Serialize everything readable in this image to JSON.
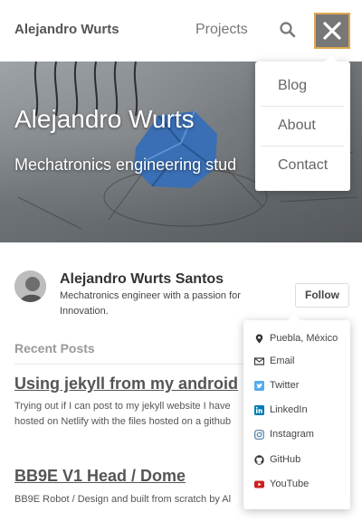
{
  "header": {
    "brand": "Alejandro Wurts",
    "nav_projects": "Projects"
  },
  "hero": {
    "title": "Alejandro Wurts",
    "subtitle": "Mechatronics engineering stud"
  },
  "menu": {
    "items": [
      {
        "label": "Blog"
      },
      {
        "label": "About"
      },
      {
        "label": "Contact"
      }
    ]
  },
  "author": {
    "name": "Alejandro Wurts Santos",
    "bio": "Mechatronics engineer with a passion for Innovation.",
    "follow_label": "Follow"
  },
  "follow_menu": {
    "items": [
      {
        "label": "Puebla, México",
        "icon": "map-marker-icon",
        "color": "#333333"
      },
      {
        "label": "Email",
        "icon": "envelope-icon",
        "color": "#333333"
      },
      {
        "label": "Twitter",
        "icon": "twitter-icon",
        "color": "#55acee"
      },
      {
        "label": "LinkedIn",
        "icon": "linkedin-icon",
        "color": "#007bb6"
      },
      {
        "label": "Instagram",
        "icon": "instagram-icon",
        "color": "#517fa4"
      },
      {
        "label": "GitHub",
        "icon": "github-icon",
        "color": "#333333"
      },
      {
        "label": "YouTube",
        "icon": "youtube-icon",
        "color": "#cd201f"
      }
    ]
  },
  "posts": {
    "heading": "Recent Posts",
    "items": [
      {
        "title": "Using jekyll from my android",
        "excerpt": "Trying out if I can post to my jekyll website I have hosted on Netlify with the files hosted on a github"
      },
      {
        "title": "BB9E V1 Head / Dome",
        "excerpt": "BB9E Robot / Design and built from scratch by Al"
      }
    ]
  },
  "colors": {
    "close_button_bg": "#777777",
    "close_button_border": "#e0a64f"
  }
}
